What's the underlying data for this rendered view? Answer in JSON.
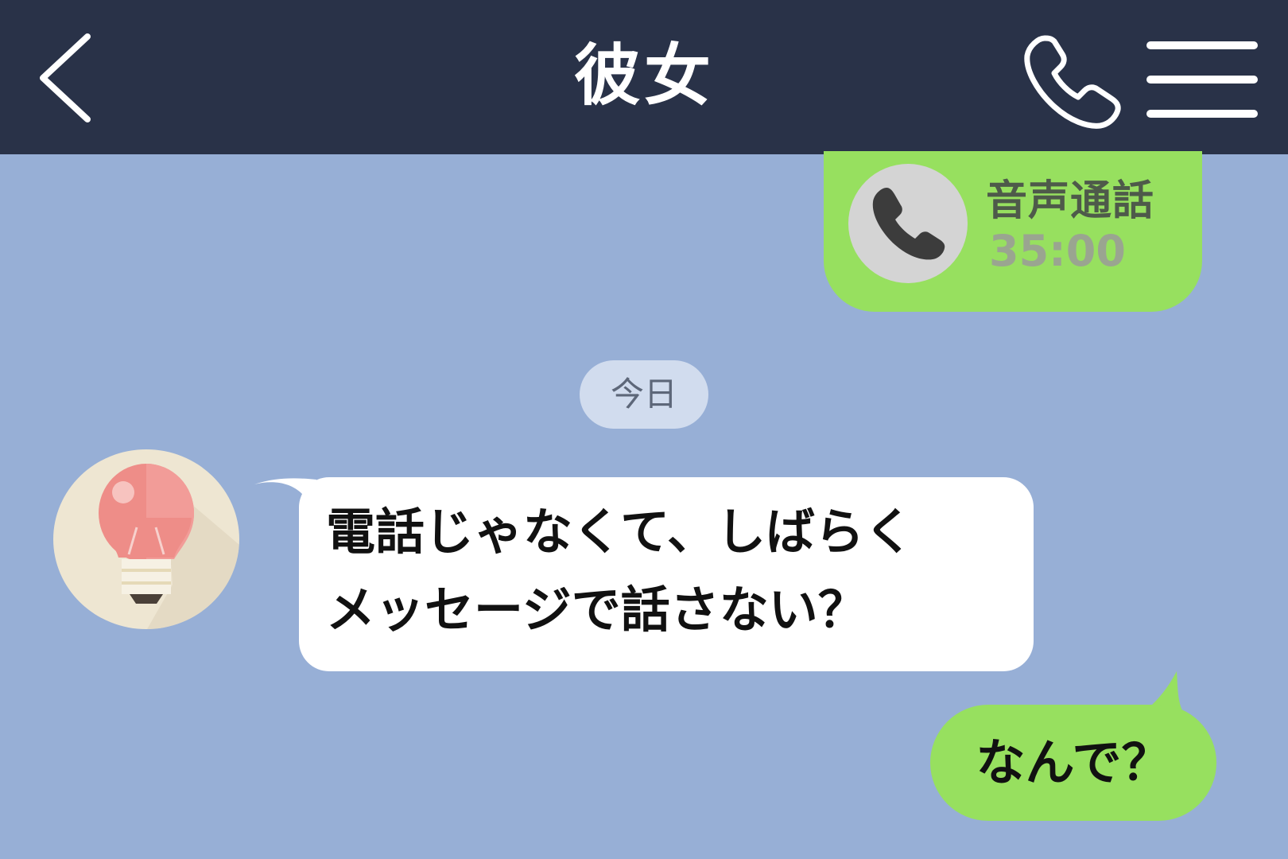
{
  "header": {
    "title": "彼女",
    "back_icon": "chevron-left-icon",
    "call_icon": "phone-icon",
    "menu_icon": "hamburger-menu-icon",
    "background": "#293248"
  },
  "chat": {
    "background": "#97AFD6",
    "call_log": {
      "icon": "phone-icon",
      "type_label": "音声通話",
      "duration": "35:00",
      "bubble_color": "#97E05F"
    },
    "date_separator": "今日",
    "received_message": {
      "avatar_icon": "light-bulb-icon",
      "lines": [
        "電話じゃなくて、しばらく",
        "メッセージで話さない？"
      ]
    },
    "sent_message": {
      "text": "なんで？",
      "bubble_color": "#97E05F"
    }
  }
}
